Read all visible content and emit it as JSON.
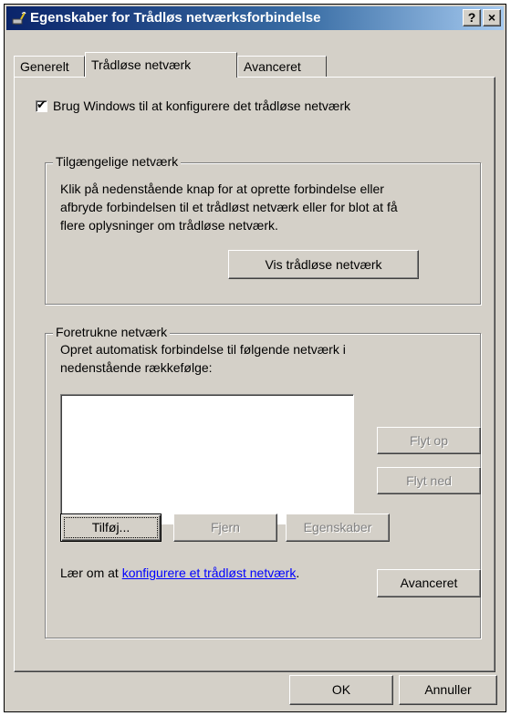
{
  "window": {
    "title": "Egenskaber for Trådløs netværksforbindelse",
    "help_button": "?",
    "close_button": "×"
  },
  "tabs": [
    {
      "label": "Generelt",
      "active": false
    },
    {
      "label": "Trådløse netværk",
      "active": true
    },
    {
      "label": "Avanceret",
      "active": false
    }
  ],
  "checkbox": {
    "label": "Brug Windows til at konfigurere det trådløse netværk",
    "checked": true
  },
  "available": {
    "title": "Tilgængelige netværk",
    "line1": "Klik på nedenstående knap for at oprette forbindelse eller",
    "line2": "afbryde forbindelsen til et trådløst netværk eller for blot at få",
    "line3": "flere oplysninger om trådløse netværk.",
    "button": "Vis trådløse netværk"
  },
  "preferred": {
    "title": "Foretrukne netværk",
    "line1": "Opret automatisk forbindelse til følgende netværk i",
    "line2": "nedenstående rækkefølge:",
    "items": [],
    "move_up": "Flyt op",
    "move_down": "Flyt ned",
    "add": "Tilføj...",
    "remove": "Fjern",
    "properties": "Egenskaber",
    "learn_prefix": "Lær om at ",
    "learn_link": "konfigurere et trådløst netværk",
    "learn_suffix": ".",
    "advanced": "Avanceret"
  },
  "footer": {
    "ok": "OK",
    "cancel": "Annuller"
  },
  "colors": {
    "titlebar": "#0a246a",
    "face": "#d4d0c8",
    "link": "#0000ff"
  }
}
